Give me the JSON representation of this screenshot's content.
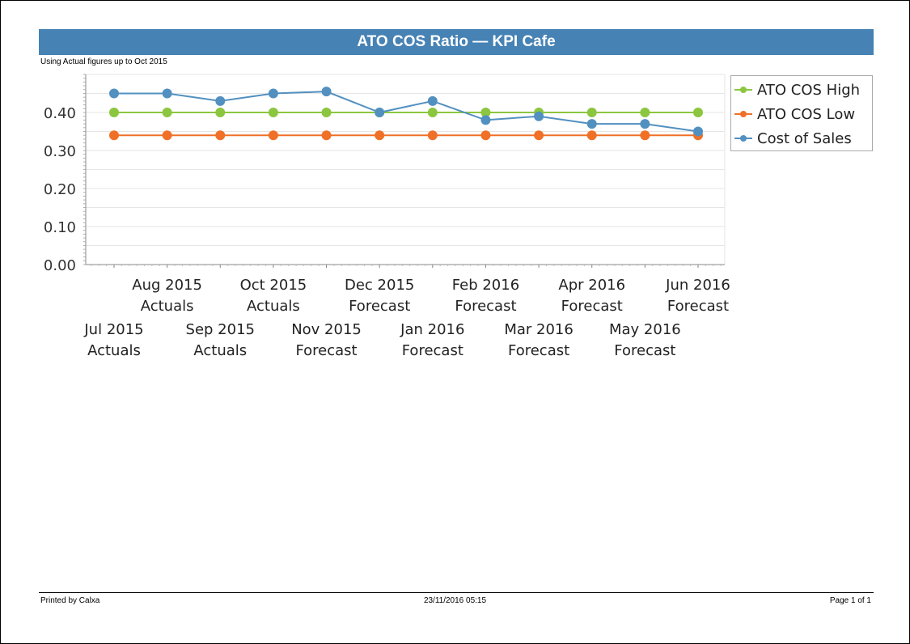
{
  "report": {
    "title": "ATO COS Ratio — KPI Cafe",
    "subtitle": "Using Actual figures up to Oct 2015",
    "footer": {
      "printed_by": "Printed by Calxa",
      "timestamp": "23/11/2016 05:15",
      "page": "Page 1 of 1"
    }
  },
  "colors": {
    "title_bar": "#4682b4",
    "high": "#8cc63f",
    "low": "#f07028",
    "cost": "#5290c0"
  },
  "chart_data": {
    "type": "line",
    "title": "ATO COS Ratio — KPI Cafe",
    "xlabel": "",
    "ylabel": "",
    "ylim": [
      0,
      0.5
    ],
    "yticks": [
      "0.00",
      "0.10",
      "0.20",
      "0.30",
      "0.40"
    ],
    "ytick_values": [
      0,
      0.1,
      0.2,
      0.3,
      0.4
    ],
    "minor_grid_step": 0.05,
    "grid": true,
    "legend_position": "right",
    "categories": [
      {
        "month": "Jul 2015",
        "kind": "Actuals"
      },
      {
        "month": "Aug 2015",
        "kind": "Actuals"
      },
      {
        "month": "Sep 2015",
        "kind": "Actuals"
      },
      {
        "month": "Oct 2015",
        "kind": "Actuals"
      },
      {
        "month": "Nov 2015",
        "kind": "Forecast"
      },
      {
        "month": "Dec 2015",
        "kind": "Forecast"
      },
      {
        "month": "Jan 2016",
        "kind": "Forecast"
      },
      {
        "month": "Feb 2016",
        "kind": "Forecast"
      },
      {
        "month": "Mar 2016",
        "kind": "Forecast"
      },
      {
        "month": "Apr 2016",
        "kind": "Forecast"
      },
      {
        "month": "May 2016",
        "kind": "Forecast"
      },
      {
        "month": "Jun 2016",
        "kind": "Forecast"
      }
    ],
    "series": [
      {
        "name": "ATO COS High",
        "key": "high",
        "values": [
          0.4,
          0.4,
          0.4,
          0.4,
          0.4,
          0.4,
          0.4,
          0.4,
          0.4,
          0.4,
          0.4,
          0.4
        ]
      },
      {
        "name": "ATO COS Low",
        "key": "low",
        "values": [
          0.34,
          0.34,
          0.34,
          0.34,
          0.34,
          0.34,
          0.34,
          0.34,
          0.34,
          0.34,
          0.34,
          0.34
        ]
      },
      {
        "name": "Cost of Sales",
        "key": "cost",
        "values": [
          0.45,
          0.45,
          0.43,
          0.45,
          0.455,
          0.4,
          0.43,
          0.38,
          0.39,
          0.37,
          0.37,
          0.35
        ]
      }
    ]
  }
}
